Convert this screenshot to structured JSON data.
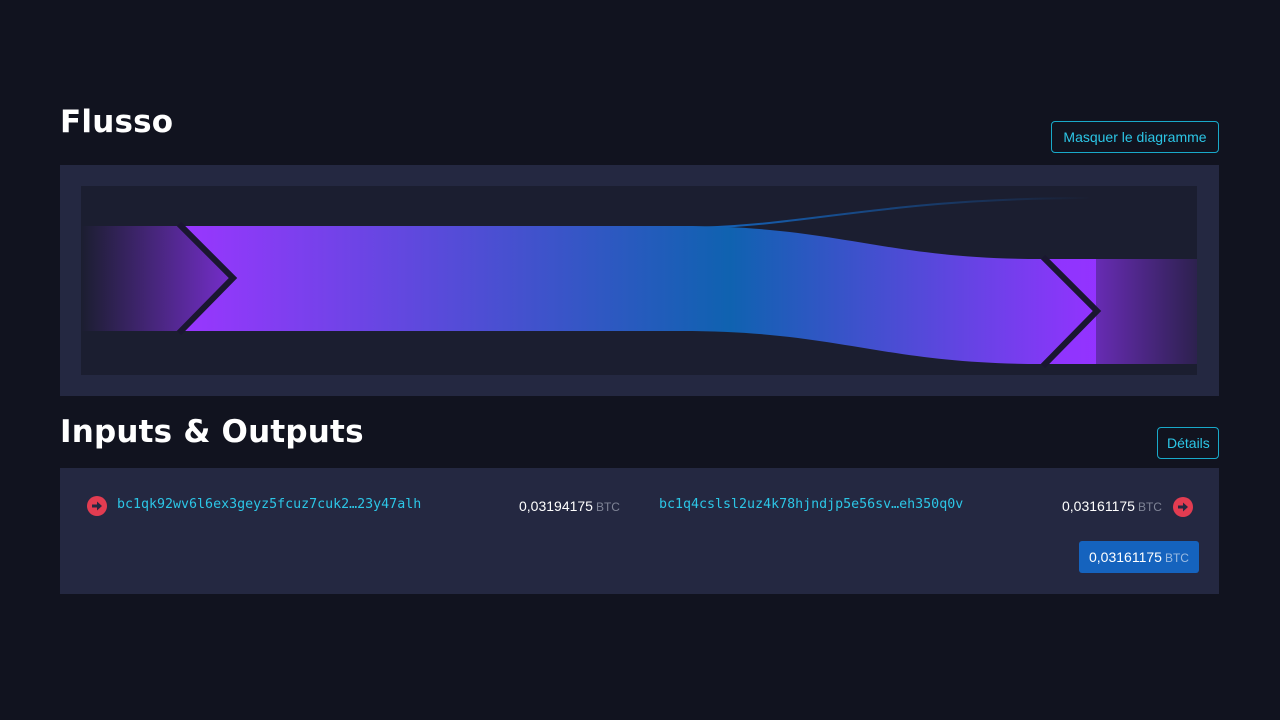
{
  "flow": {
    "title": "Flusso",
    "toggle_label": "Masquer le diagramme",
    "colors": {
      "purple": "#9333ff",
      "blue": "#0f62b0",
      "divider": "#1a1730"
    }
  },
  "io": {
    "title": "Inputs & Outputs",
    "details_label": "Détails",
    "inputs": [
      {
        "address": "bc1qk92wv6l6ex3geyz5fcuz7cuk2…23y47alh",
        "amount": "0,03194175",
        "unit": "BTC",
        "icon": "arrow-right-circle-icon"
      }
    ],
    "outputs": [
      {
        "address": "bc1q4cslsl2uz4k78hjndjp5e56sv…eh350q0v",
        "amount": "0,03161175",
        "unit": "BTC",
        "icon": "arrow-right-circle-icon"
      }
    ],
    "total": {
      "amount": "0,03161175",
      "unit": "BTC"
    },
    "colors": {
      "address": "#2cc6e6",
      "arrow": "#e23c51",
      "total_badge": "#1563be"
    }
  }
}
